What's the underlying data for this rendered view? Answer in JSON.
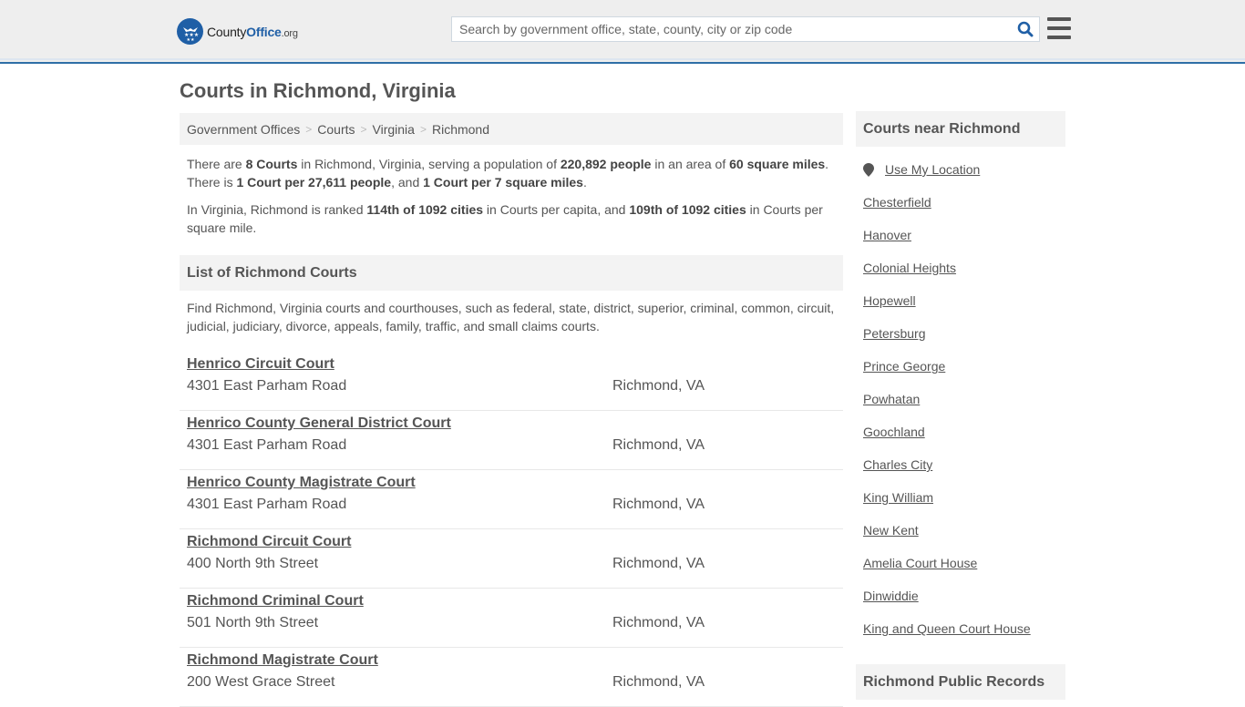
{
  "header": {
    "logo": {
      "name_part1": "County",
      "name_part2": "Office",
      "tld": ".org"
    },
    "search": {
      "placeholder": "Search by government office, state, county, city or zip code",
      "value": ""
    },
    "icons": {
      "search": "search-icon",
      "menu": "hamburger-menu-icon",
      "logo": "eagle-stars-logo-icon"
    },
    "colors": {
      "brand": "#1f5fa6",
      "accent_line": "#2f6fa6"
    }
  },
  "page": {
    "title": "Courts in Richmond, Virginia"
  },
  "breadcrumb": [
    {
      "label": "Government Offices"
    },
    {
      "label": "Courts"
    },
    {
      "label": "Virginia"
    },
    {
      "label": "Richmond"
    }
  ],
  "intro": {
    "p1": {
      "t1": "There are ",
      "b1": "8 Courts",
      "t2": " in Richmond, Virginia, serving a population of ",
      "b2": "220,892 people",
      "t3": " in an area of ",
      "b3": "60 square miles",
      "t4": ". There is ",
      "b4": "1 Court per 27,611 people",
      "t5": ", and ",
      "b5": "1 Court per 7 square miles",
      "t6": "."
    },
    "p2": {
      "t1": "In Virginia, Richmond is ranked ",
      "b1": "114th of 1092 cities",
      "t2": " in Courts per capita, and ",
      "b2": "109th of 1092 cities",
      "t3": " in Courts per square mile."
    }
  },
  "list": {
    "heading": "List of Richmond Courts",
    "description": "Find Richmond, Virginia courts and courthouses, such as federal, state, district, superior, criminal, common, circuit, judicial, judiciary, divorce, appeals, family, traffic, and small claims courts.",
    "courts": [
      {
        "name": "Henrico Circuit Court",
        "address": "4301 East Parham Road",
        "city": "Richmond, VA"
      },
      {
        "name": "Henrico County General District Court",
        "address": "4301 East Parham Road",
        "city": "Richmond, VA"
      },
      {
        "name": "Henrico County Magistrate Court",
        "address": "4301 East Parham Road",
        "city": "Richmond, VA"
      },
      {
        "name": "Richmond Circuit Court",
        "address": "400 North 9th Street",
        "city": "Richmond, VA"
      },
      {
        "name": "Richmond Criminal Court",
        "address": "501 North 9th Street",
        "city": "Richmond, VA"
      },
      {
        "name": "Richmond Magistrate Court",
        "address": "200 West Grace Street",
        "city": "Richmond, VA"
      }
    ]
  },
  "sidebar": {
    "nearby_heading": "Courts near Richmond",
    "use_location": "Use My Location",
    "nearby": [
      "Chesterfield",
      "Hanover",
      "Colonial Heights",
      "Hopewell",
      "Petersburg",
      "Prince George",
      "Powhatan",
      "Goochland",
      "Charles City",
      "King William",
      "New Kent",
      "Amelia Court House",
      "Dinwiddie",
      "King and Queen Court House"
    ],
    "records_heading": "Richmond Public Records"
  }
}
